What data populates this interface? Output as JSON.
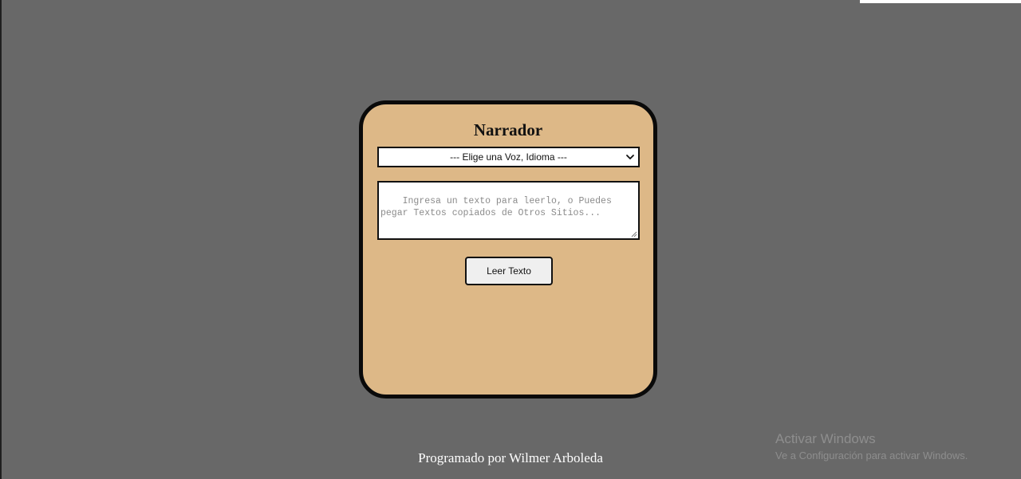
{
  "app": {
    "title": "Narrador"
  },
  "voice_select": {
    "selected": "--- Elige una Voz, Idioma ---"
  },
  "text_input": {
    "placeholder": "Ingresa un texto para leerlo, o Puedes pegar Textos copiados de Otros Sitios...",
    "value": ""
  },
  "read_button": {
    "label": "Leer Texto"
  },
  "footer": {
    "credit": "Programado por Wilmer Arboleda"
  },
  "os_watermark": {
    "title": "Activar Windows",
    "subtitle": "Ve a Configuración para activar Windows."
  },
  "colors": {
    "page_background": "#686868",
    "card_background": "#ddb887",
    "card_border": "#0a0a0a",
    "button_background": "#efefef",
    "footer_text": "#ffffff"
  },
  "icons": {
    "select_arrow": "chevron-down-icon",
    "resize_handle": "resize-grip-icon"
  }
}
